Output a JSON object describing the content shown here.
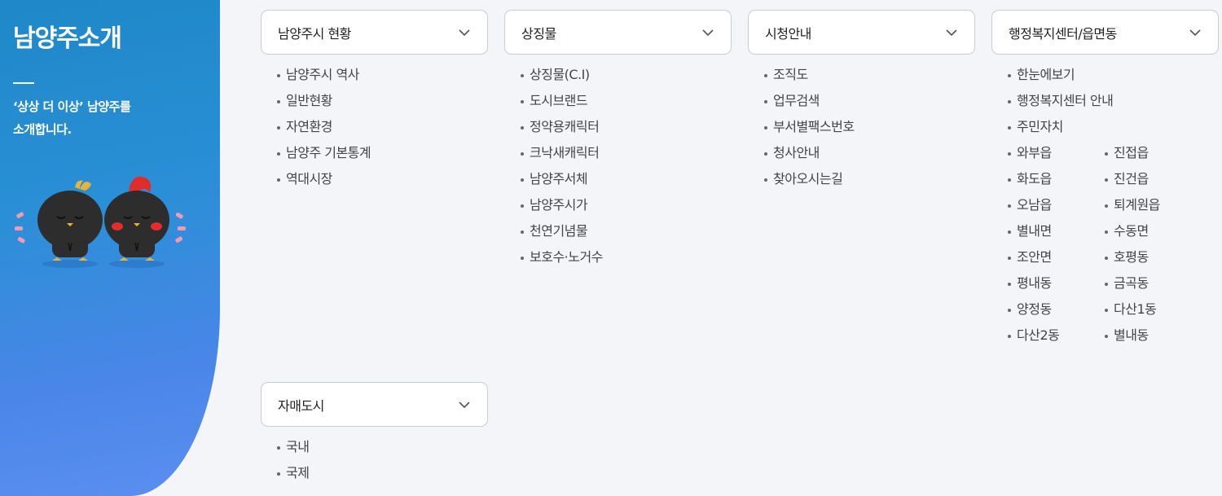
{
  "sidebar": {
    "title": "남양주소개",
    "desc_line1": "‘상상 더 이상’ 남양주를",
    "desc_line2": "소개합니다."
  },
  "menus": [
    {
      "label": "남양주시 현황",
      "items": [
        "남양주시 역사",
        "일반현황",
        "자연환경",
        "남양주 기본통계",
        "역대시장"
      ]
    },
    {
      "label": "상징물",
      "items": [
        "상징물(C.I)",
        "도시브랜드",
        "정약용캐릭터",
        "크낙새캐릭터",
        "남양주서체",
        "남양주시가",
        "천연기념물",
        "보호수·노거수"
      ]
    },
    {
      "label": "시청안내",
      "items": [
        "조직도",
        "업무검색",
        "부서별팩스번호",
        "청사안내",
        "찾아오시는길"
      ]
    },
    {
      "label": "행정복지센터/읍면동",
      "items": [
        "한눈에보기",
        "행정복지센터 안내",
        "주민자치"
      ],
      "grid": [
        "와부읍",
        "진접읍",
        "화도읍",
        "진건읍",
        "오남읍",
        "퇴계원읍",
        "별내면",
        "수동면",
        "조안면",
        "호평동",
        "평내동",
        "금곡동",
        "양정동",
        "다산1동",
        "다산2동",
        "별내동"
      ]
    },
    {
      "label": "자매도시",
      "items": [
        "국내",
        "국제"
      ]
    }
  ],
  "icons": {
    "dropdown": "chevron-down-icon"
  },
  "colors": {
    "sidebar_top": "#1e88c8",
    "sidebar_bottom": "#5b8ff0",
    "background": "#f4f5f9"
  }
}
